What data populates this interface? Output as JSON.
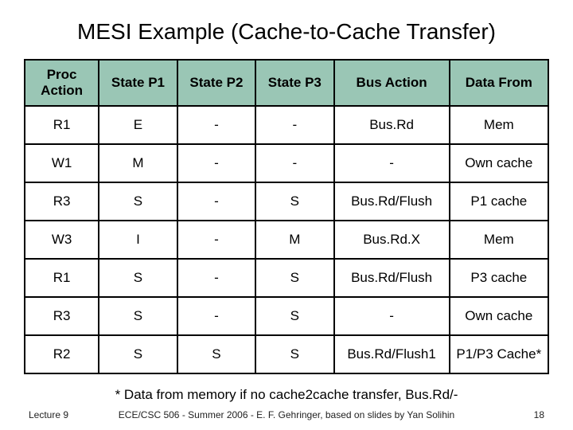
{
  "title": "MESI Example (Cache-to-Cache Transfer)",
  "table": {
    "headers": [
      "Proc Action",
      "State P1",
      "State P2",
      "State P3",
      "Bus Action",
      "Data From"
    ],
    "rows": [
      [
        "R1",
        "E",
        "-",
        "-",
        "Bus.Rd",
        "Mem"
      ],
      [
        "W1",
        "M",
        "-",
        "-",
        "-",
        "Own cache"
      ],
      [
        "R3",
        "S",
        "-",
        "S",
        "Bus.Rd/Flush",
        "P1 cache"
      ],
      [
        "W3",
        "I",
        "-",
        "M",
        "Bus.Rd.X",
        "Mem"
      ],
      [
        "R1",
        "S",
        "-",
        "S",
        "Bus.Rd/Flush",
        "P3 cache"
      ],
      [
        "R3",
        "S",
        "-",
        "S",
        "-",
        "Own cache"
      ],
      [
        "R2",
        "S",
        "S",
        "S",
        "Bus.Rd/Flush1",
        "P1/P3 Cache*"
      ]
    ]
  },
  "footnote": "* Data from memory if no cache2cache transfer, Bus.Rd/-",
  "footer": {
    "lecture": "Lecture 9",
    "credit": "ECE/CSC 506 - Summer 2006 - E. F. Gehringer, based on slides by Yan Solihin",
    "page": "18"
  }
}
